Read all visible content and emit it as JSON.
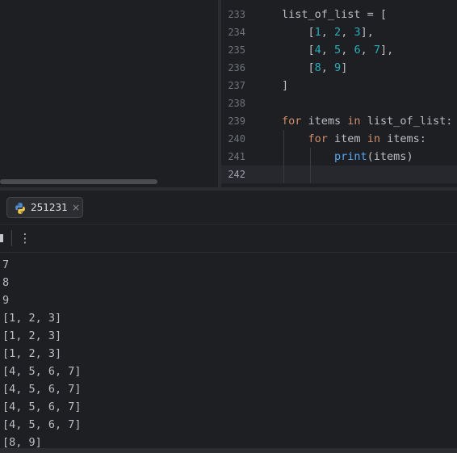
{
  "editor": {
    "lines": [
      {
        "num": "233",
        "segments": [
          {
            "t": "list_of_list = [",
            "c": "txt"
          }
        ]
      },
      {
        "num": "234",
        "segments": [
          {
            "t": "    [",
            "c": "txt"
          },
          {
            "t": "1",
            "c": "num"
          },
          {
            "t": ", ",
            "c": "txt"
          },
          {
            "t": "2",
            "c": "num"
          },
          {
            "t": ", ",
            "c": "txt"
          },
          {
            "t": "3",
            "c": "num"
          },
          {
            "t": "],",
            "c": "txt"
          }
        ]
      },
      {
        "num": "235",
        "segments": [
          {
            "t": "    [",
            "c": "txt"
          },
          {
            "t": "4",
            "c": "num"
          },
          {
            "t": ", ",
            "c": "txt"
          },
          {
            "t": "5",
            "c": "num"
          },
          {
            "t": ", ",
            "c": "txt"
          },
          {
            "t": "6",
            "c": "num"
          },
          {
            "t": ", ",
            "c": "txt"
          },
          {
            "t": "7",
            "c": "num"
          },
          {
            "t": "],",
            "c": "txt"
          }
        ]
      },
      {
        "num": "236",
        "segments": [
          {
            "t": "    [",
            "c": "txt"
          },
          {
            "t": "8",
            "c": "num"
          },
          {
            "t": ", ",
            "c": "txt"
          },
          {
            "t": "9",
            "c": "num"
          },
          {
            "t": "]",
            "c": "txt"
          }
        ]
      },
      {
        "num": "237",
        "segments": [
          {
            "t": "]",
            "c": "txt"
          }
        ]
      },
      {
        "num": "238",
        "segments": []
      },
      {
        "num": "239",
        "segments": [
          {
            "t": "for",
            "c": "kw"
          },
          {
            "t": " items ",
            "c": "txt"
          },
          {
            "t": "in",
            "c": "kw"
          },
          {
            "t": " list_of_list:",
            "c": "txt"
          }
        ]
      },
      {
        "num": "240",
        "segments": [
          {
            "t": "    ",
            "c": "txt"
          },
          {
            "t": "for",
            "c": "kw"
          },
          {
            "t": " item ",
            "c": "txt"
          },
          {
            "t": "in",
            "c": "kw"
          },
          {
            "t": " items:",
            "c": "txt"
          }
        ]
      },
      {
        "num": "241",
        "segments": [
          {
            "t": "        ",
            "c": "txt"
          },
          {
            "t": "print",
            "c": "fn"
          },
          {
            "t": "(items)",
            "c": "txt"
          }
        ]
      },
      {
        "num": "242",
        "segments": [],
        "current": true
      }
    ]
  },
  "run_tab": {
    "icon": "python-icon",
    "label": "251231",
    "close": "×"
  },
  "toolbar": {
    "stop_icon": "stop-icon",
    "more_label": "⋮"
  },
  "console": {
    "lines": [
      "7",
      "8",
      "9",
      "[1, 2, 3]",
      "[1, 2, 3]",
      "[1, 2, 3]",
      "[4, 5, 6, 7]",
      "[4, 5, 6, 7]",
      "[4, 5, 6, 7]",
      "[4, 5, 6, 7]",
      "[8, 9]"
    ]
  },
  "colors": {
    "background": "#1e1f22",
    "keyword": "#cf8e6d",
    "number": "#2aacb8",
    "function": "#56a8f5",
    "text": "#bcbec4"
  }
}
